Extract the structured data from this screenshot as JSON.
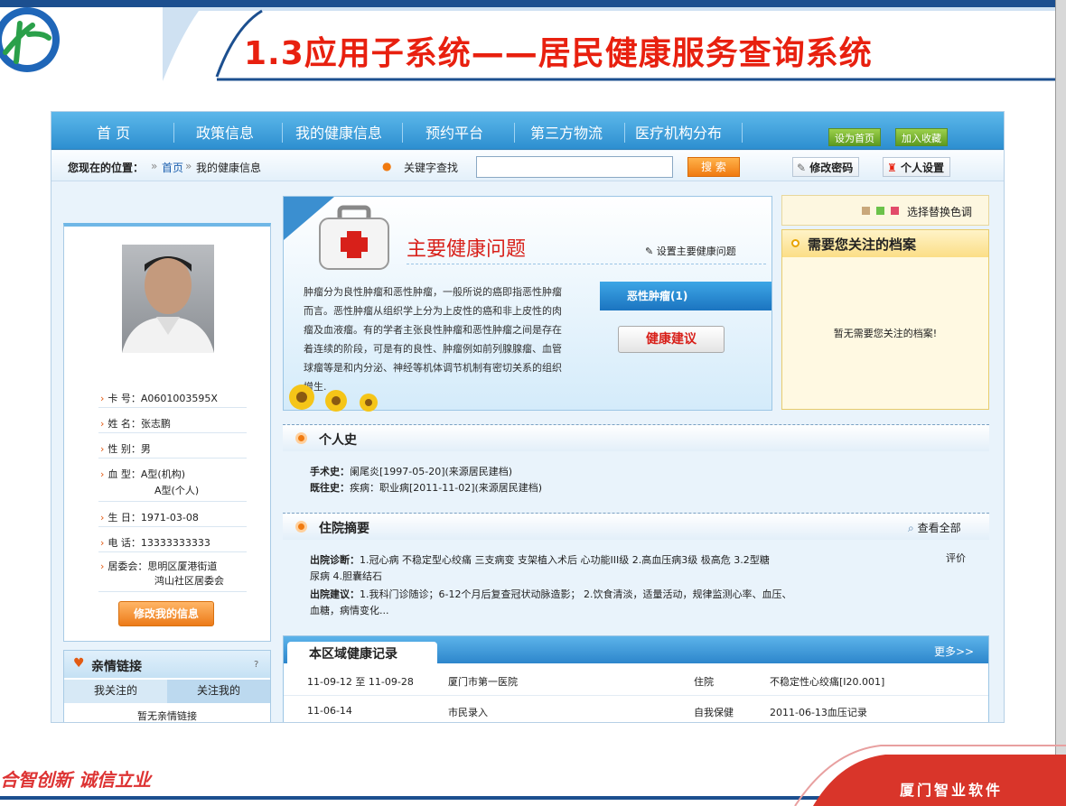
{
  "slide": {
    "title": "1.3应用子系统——居民健康服务查询系统",
    "footer_left": "合智创新  诚信立业",
    "footer_right": "厦门智业软件"
  },
  "nav": {
    "items": [
      "首 页",
      "政策信息",
      "我的健康信息",
      "预约平台",
      "第三方物流",
      "医疗机构分布"
    ],
    "set_home": "设为首页",
    "bookmark": "加入收藏"
  },
  "breadcrumb": {
    "label": "您现在的位置：",
    "home": "首页",
    "current": "我的健康信息",
    "search_label": "关键字查找",
    "search_value": "",
    "search_button": "搜 索",
    "change_password": "修改密码",
    "personal_settings": "个人设置"
  },
  "profile": {
    "card_label": "卡  号：",
    "card": "A0601003595X",
    "name_label": "姓  名：",
    "name": "张志鹏",
    "gender_label": "性  别：",
    "gender": "男",
    "blood_label": "血  型：",
    "blood_org": "A型(机构)",
    "blood_self": "A型(个人)",
    "birth_label": "生  日：",
    "birth": "1971-03-08",
    "phone_label": "电  话：",
    "phone": "13333333333",
    "committee_label": "居委会：",
    "committee_1": "思明区厦港街道",
    "committee_2": "鸿山社区居委会",
    "edit_button": "修改我的信息"
  },
  "family": {
    "title": "亲情链接",
    "tab_following": "我关注的",
    "tab_followers": "关注我的",
    "empty": "暂无亲情链接"
  },
  "health": {
    "title": "主要健康问题",
    "set_link": "设置主要健康问题",
    "desc": "肿瘤分为良性肿瘤和恶性肿瘤，一般所说的癌即指恶性肿瘤而言。恶性肿瘤从组织学上分为上皮性的癌和非上皮性的肉瘤及血液瘤。有的学者主张良性肿瘤和恶性肿瘤之间是存在着连续的阶段，可是有的良性、肿瘤例如前列腺腺瘤、血管球瘤等是和内分泌、神经等机体调节机制有密切关系的组织增生.",
    "tumor_tab": "恶性肿瘤(1)",
    "advice_button": "健康建议"
  },
  "right": {
    "color_label": "选择替换色调",
    "archive_title": "需要您关注的档案",
    "archive_empty": "暂无需要您关注的档案!"
  },
  "personal_history": {
    "title": "个人史",
    "surgery_label": "手术史：",
    "surgery": "阑尾炎[1997-05-20](来源居民建档)",
    "past_label": "既往史：",
    "past": "疾病：职业病[2011-11-02](来源居民建档)"
  },
  "hospital": {
    "title": "住院摘要",
    "view_all": "查看全部",
    "diag_label": "出院诊断：",
    "diag_1": "1.冠心病 不稳定型心绞痛 三支病变 支架植入术后 心功能III级 2.高血压病3级  极高危 3.2型糖",
    "diag_2": "尿病 4.胆囊结石",
    "evaluate": "评价",
    "advice_label": "出院建议：",
    "advice_1": "1.我科门诊随诊；6-12个月后复查冠状动脉造影；  2.饮食清淡，适量活动，规律监测心率、血压、",
    "advice_2": "血糖，病情变化..."
  },
  "records": {
    "title": "本区域健康记录",
    "more": "更多>>",
    "rows": [
      {
        "date": "11-09-12 至 11-09-28",
        "org": "厦门市第一医院",
        "type": "住院",
        "desc": "不稳定性心绞痛[I20.001]"
      },
      {
        "date": "11-06-14",
        "org": "市民录入",
        "type": "自我保健",
        "desc": "2011-06-13血压记录"
      }
    ]
  },
  "colors": {
    "title_red": "#e8200f",
    "nav_blue": "#2d8fd0",
    "accent_orange": "#f07a10"
  }
}
